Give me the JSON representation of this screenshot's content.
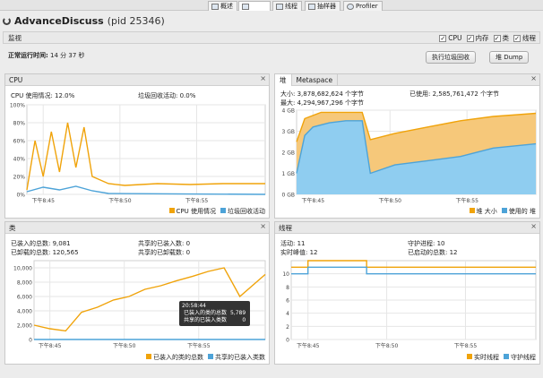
{
  "tabs": [
    {
      "label": "概述",
      "icon": "overview-icon"
    },
    {
      "label": "",
      "icon": "monitor-icon"
    },
    {
      "label": "线程",
      "icon": "threads-icon"
    },
    {
      "label": "抽样器",
      "icon": "sampler-icon"
    },
    {
      "label": "Profiler",
      "icon": "profiler-icon"
    }
  ],
  "app": {
    "title": "AdvanceDiscuss",
    "pid": "(pid 25346)"
  },
  "monitor": {
    "header": "监视",
    "checks": [
      {
        "label": "CPU",
        "checked": true
      },
      {
        "label": "内存",
        "checked": true
      },
      {
        "label": "类",
        "checked": true
      },
      {
        "label": "线程",
        "checked": true
      }
    ],
    "uptime_label": "正常运行时间:",
    "uptime_value": "14 分 37 秒",
    "gc_button": "执行垃圾回收",
    "heapdump_button": "堆 Dump"
  },
  "cpu": {
    "title": "CPU",
    "usage": "CPU 使用情况:  12.0%",
    "gc": "垃圾回收活动:  0.0%",
    "legend": [
      "CPU 使用情况",
      "垃圾回收活动"
    ]
  },
  "heap": {
    "tabs": [
      "堆",
      "Metaspace"
    ],
    "size": "大小:  3,878,682,624 个字节",
    "max": "最大:  4,294,967,296 个字节",
    "used": "已使用:  2,585,761,472 个字节",
    "legend": [
      "堆 大小",
      "使用的 堆"
    ]
  },
  "classes": {
    "title": "类",
    "loaded": "已装入的总数:  9,081",
    "unloaded": "已卸载的总数:  120,565",
    "shared_loaded": "共享的已装入数:  0",
    "shared_unloaded": "共享的已卸载数:  0",
    "legend": [
      "已装入的类的总数",
      "共享的已装入类数"
    ],
    "tooltip": {
      "time": "20:58:44",
      "rows": [
        {
          "label": "已装入的类的总数",
          "value": "5,789"
        },
        {
          "label": "共享的已装入类数",
          "value": "0"
        }
      ]
    }
  },
  "threads": {
    "title": "线程",
    "live": "活动:  11",
    "peak": "实时峰值:  12",
    "daemon": "守护进程:  10",
    "started": "已启动的总数:  12",
    "legend": [
      "实时线程",
      "守护线程"
    ]
  },
  "colors": {
    "orange": "#f0a30a",
    "blue": "#4da3d8",
    "orange_fill": "#f6c87a",
    "blue_fill": "#8fcdf0"
  },
  "chart_data": [
    {
      "type": "line",
      "title": "CPU",
      "yticks": [
        "0%",
        "20%",
        "40%",
        "60%",
        "80%",
        "100%"
      ],
      "ylim": [
        0,
        100
      ],
      "xticks": [
        "下午8:45",
        "下午8:50",
        "下午8:55"
      ],
      "series": [
        {
          "name": "CPU 使用情况",
          "x": [
            0,
            0.5,
            1,
            1.5,
            2,
            2.5,
            3,
            3.5,
            4,
            5,
            6,
            8,
            10,
            12,
            14.6
          ],
          "values": [
            5,
            60,
            20,
            70,
            25,
            80,
            30,
            75,
            20,
            12,
            10,
            12,
            11,
            12,
            12
          ]
        },
        {
          "name": "垃圾回收活动",
          "x": [
            0,
            1,
            2,
            3,
            4,
            5,
            14.6
          ],
          "values": [
            3,
            8,
            5,
            9,
            4,
            1,
            0
          ]
        }
      ]
    },
    {
      "type": "area",
      "title": "堆",
      "yticks": [
        "0 GB",
        "1 GB",
        "2 GB",
        "3 GB",
        "4 GB"
      ],
      "ylim": [
        0,
        4
      ],
      "xticks": [
        "下午8:45",
        "下午8:50",
        "下午8:55"
      ],
      "series": [
        {
          "name": "堆 大小",
          "x": [
            0,
            0.5,
            1.5,
            4,
            4.5,
            6,
            8,
            10,
            12,
            14.6
          ],
          "values": [
            2.5,
            3.6,
            3.9,
            3.9,
            2.6,
            2.9,
            3.2,
            3.5,
            3.7,
            3.85
          ]
        },
        {
          "name": "使用的 堆",
          "x": [
            0,
            0.5,
            1,
            2,
            3,
            4,
            4.5,
            6,
            8,
            10,
            12,
            14.6
          ],
          "values": [
            1.0,
            2.8,
            3.2,
            3.4,
            3.5,
            3.5,
            1.0,
            1.4,
            1.6,
            1.8,
            2.2,
            2.4
          ]
        }
      ]
    },
    {
      "type": "line",
      "title": "类",
      "yticks": [
        "0",
        "2,000",
        "4,000",
        "6,000",
        "8,000",
        "10,000"
      ],
      "ylim": [
        0,
        11000
      ],
      "xticks": [
        "下午8:45",
        "下午8:50",
        "下午8:55"
      ],
      "series": [
        {
          "name": "已装入的类的总数",
          "x": [
            0,
            1,
            2,
            3,
            4,
            5,
            6,
            7,
            8,
            9,
            10,
            11,
            12,
            13,
            14.6
          ],
          "values": [
            2000,
            1500,
            1200,
            3800,
            4500,
            5500,
            6000,
            7000,
            7500,
            8200,
            8800,
            9500,
            10000,
            6000,
            9081
          ]
        },
        {
          "name": "共享的已装入类数",
          "x": [
            0,
            14.6
          ],
          "values": [
            0,
            0
          ]
        }
      ]
    },
    {
      "type": "line",
      "title": "线程",
      "yticks": [
        "0",
        "2",
        "4",
        "6",
        "8",
        "10"
      ],
      "ylim": [
        0,
        12
      ],
      "xticks": [
        "下午8:45",
        "下午8:50",
        "下午8:55"
      ],
      "series": [
        {
          "name": "实时线程",
          "x": [
            0,
            1,
            4.5,
            14.6
          ],
          "values": [
            11,
            12,
            11,
            11
          ]
        },
        {
          "name": "守护线程",
          "x": [
            0,
            1,
            4.5,
            14.6
          ],
          "values": [
            10,
            11,
            10,
            10
          ]
        }
      ]
    }
  ]
}
